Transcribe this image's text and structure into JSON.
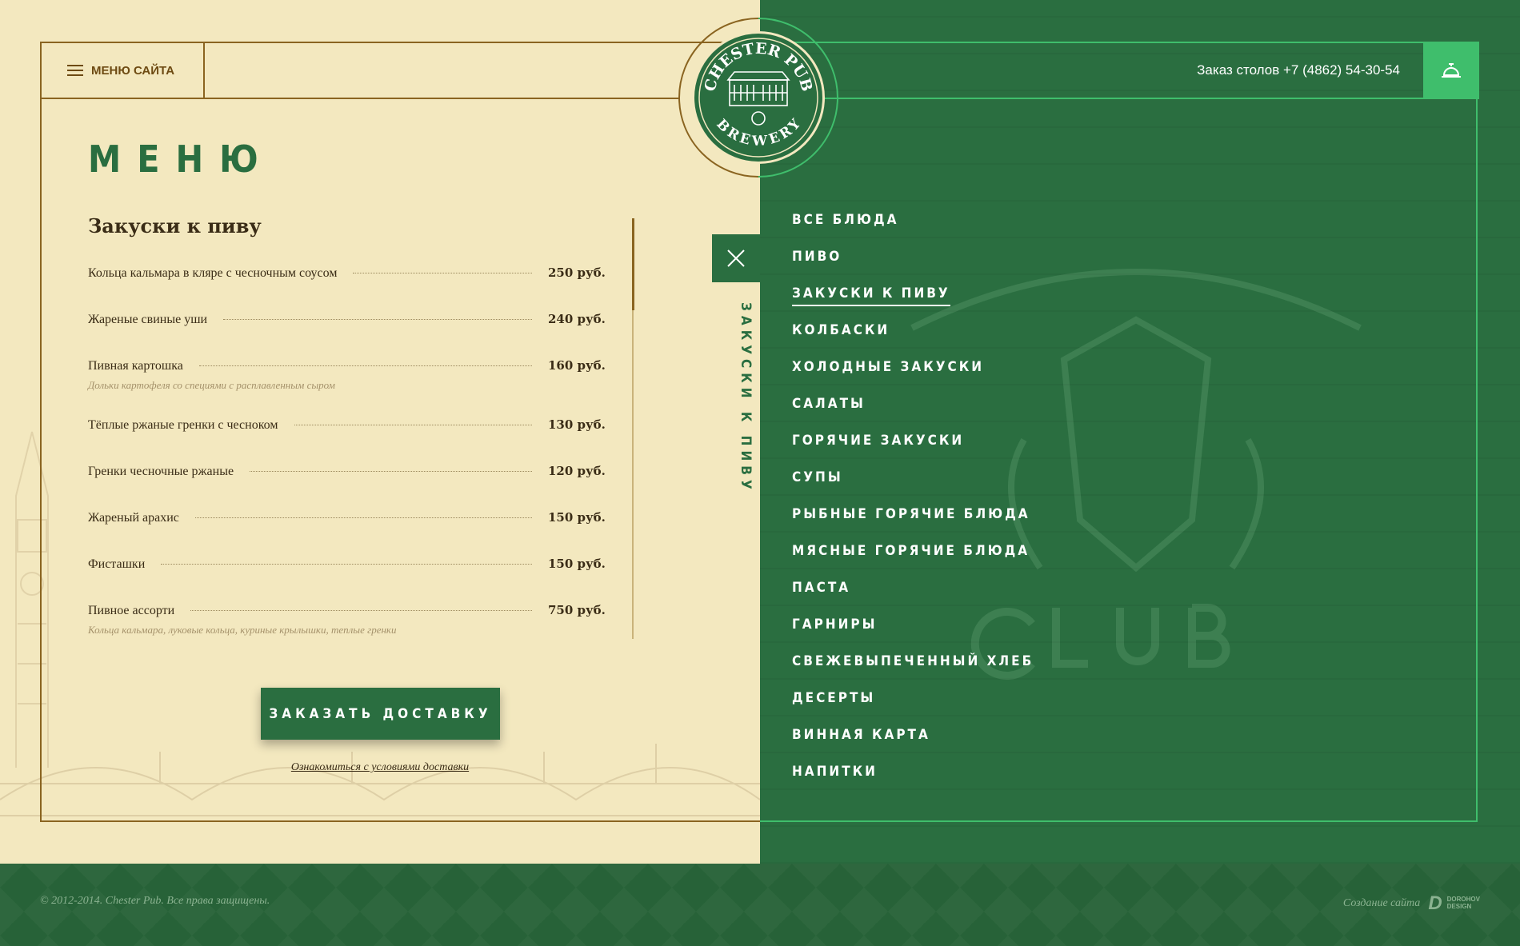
{
  "header": {
    "menu_site_label": "МЕНЮ САЙТА",
    "phone_text": "Заказ столов +7 (4862) 54-30-54"
  },
  "logo": {
    "top_text": "CHESTER PUB",
    "bottom_text": "BREWERY"
  },
  "menu": {
    "title": "МЕНЮ",
    "section_title": "Закуски к пиву",
    "items": [
      {
        "name": "Кольца кальмара в кляре с чесночным соусом",
        "price": "250 руб.",
        "desc": ""
      },
      {
        "name": "Жареные свиные уши",
        "price": "240 руб.",
        "desc": ""
      },
      {
        "name": "Пивная картошка",
        "price": "160 руб.",
        "desc": "Дольки картофеля со специями с расплавленным сыром"
      },
      {
        "name": "Тёплые ржаные гренки с чесноком",
        "price": "130 руб.",
        "desc": ""
      },
      {
        "name": "Гренки чесночные ржаные",
        "price": "120 руб.",
        "desc": ""
      },
      {
        "name": "Жареный арахис",
        "price": "150 руб.",
        "desc": ""
      },
      {
        "name": "Фисташки",
        "price": "150 руб.",
        "desc": ""
      },
      {
        "name": "Пивное ассорти",
        "price": "750 руб.",
        "desc": "Кольца кальмара, луковые кольца, куриные крылышки, теплые гренки"
      }
    ],
    "order_button": "ЗАКАЗАТЬ ДОСТАВКУ",
    "delivery_link": "Ознакомиться с условиями доставки",
    "vertical_label": "ЗАКУСКИ К ПИВУ"
  },
  "categories": [
    {
      "label": "ВСЕ БЛЮДА",
      "active": false
    },
    {
      "label": "ПИВО",
      "active": false
    },
    {
      "label": "ЗАКУСКИ К ПИВУ",
      "active": true
    },
    {
      "label": "КОЛБАСКИ",
      "active": false
    },
    {
      "label": "ХОЛОДНЫЕ ЗАКУСКИ",
      "active": false
    },
    {
      "label": "САЛАТЫ",
      "active": false
    },
    {
      "label": "ГОРЯЧИЕ ЗАКУСКИ",
      "active": false
    },
    {
      "label": "СУПЫ",
      "active": false
    },
    {
      "label": "РЫБНЫЕ ГОРЯЧИЕ БЛЮДА",
      "active": false
    },
    {
      "label": "МЯСНЫЕ ГОРЯЧИЕ БЛЮДА",
      "active": false
    },
    {
      "label": "ПАСТА",
      "active": false
    },
    {
      "label": "ГАРНИРЫ",
      "active": false
    },
    {
      "label": "СВЕЖЕВЫПЕЧЕННЫЙ ХЛЕБ",
      "active": false
    },
    {
      "label": "ДЕСЕРТЫ",
      "active": false
    },
    {
      "label": "ВИННАЯ КАРТА",
      "active": false
    },
    {
      "label": "НАПИТКИ",
      "active": false
    }
  ],
  "footer": {
    "copyright": "© 2012-2014. Chester Pub. Все права защищены.",
    "credit_label": "Создание сайта",
    "credit_brand_line1": "DOROHOV",
    "credit_brand_line2": "DESIGN",
    "credit_mark": "D"
  },
  "icons": {
    "menu": "hamburger-icon",
    "bell": "service-bell-icon",
    "close": "close-icon"
  },
  "colors": {
    "green": "#2a6e40",
    "accent_green": "#3fbe6c",
    "cream": "#f3e8bf",
    "brown": "#8a6420"
  }
}
